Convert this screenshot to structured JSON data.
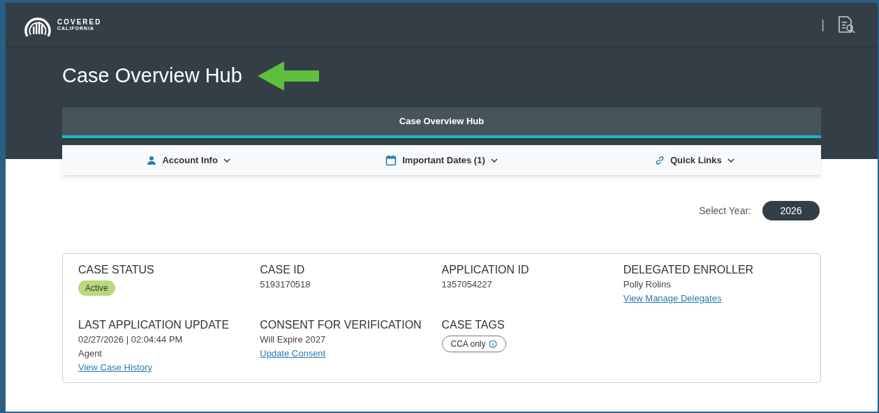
{
  "header": {
    "logo": {
      "line_1": "COVERED",
      "line_2": "CALIFORNIA"
    },
    "divider": "|"
  },
  "page_title": "Case Overview Hub",
  "hub_bar": {
    "title": "Case Overview Hub"
  },
  "menus": [
    {
      "kind": "person",
      "label": "Account Info"
    },
    {
      "kind": "calendar",
      "label": "Important Dates (1)"
    },
    {
      "kind": "link",
      "label": "Quick Links"
    }
  ],
  "year_select": {
    "label": "Select Year:",
    "value": "2026"
  },
  "fields": [
    {
      "label": "CASE STATUS",
      "items": [
        {
          "kind": "badge",
          "text": "Active"
        }
      ]
    },
    {
      "label": "CASE ID",
      "items": [
        {
          "kind": "text",
          "text": "5193170518"
        }
      ]
    },
    {
      "label": "APPLICATION ID",
      "items": [
        {
          "kind": "text",
          "text": "1357054227"
        }
      ]
    },
    {
      "label": "DELEGATED ENROLLER",
      "items": [
        {
          "kind": "text",
          "text": "Polly Rolins"
        },
        {
          "kind": "link",
          "text": "View Manage Delegates"
        }
      ]
    },
    {
      "label": "LAST APPLICATION UPDATE",
      "items": [
        {
          "kind": "text",
          "text": "02/27/2026 | 02:04:44 PM"
        },
        {
          "kind": "text",
          "text": "Agent"
        },
        {
          "kind": "link",
          "text": "View Case History"
        }
      ]
    },
    {
      "label": "CONSENT FOR VERIFICATION",
      "items": [
        {
          "kind": "text",
          "text": "Will Expire 2027"
        },
        {
          "kind": "link",
          "text": "Update Consent"
        }
      ]
    },
    {
      "label": "CASE TAGS",
      "items": [
        {
          "kind": "tag",
          "text": "CCA only"
        }
      ]
    }
  ]
}
